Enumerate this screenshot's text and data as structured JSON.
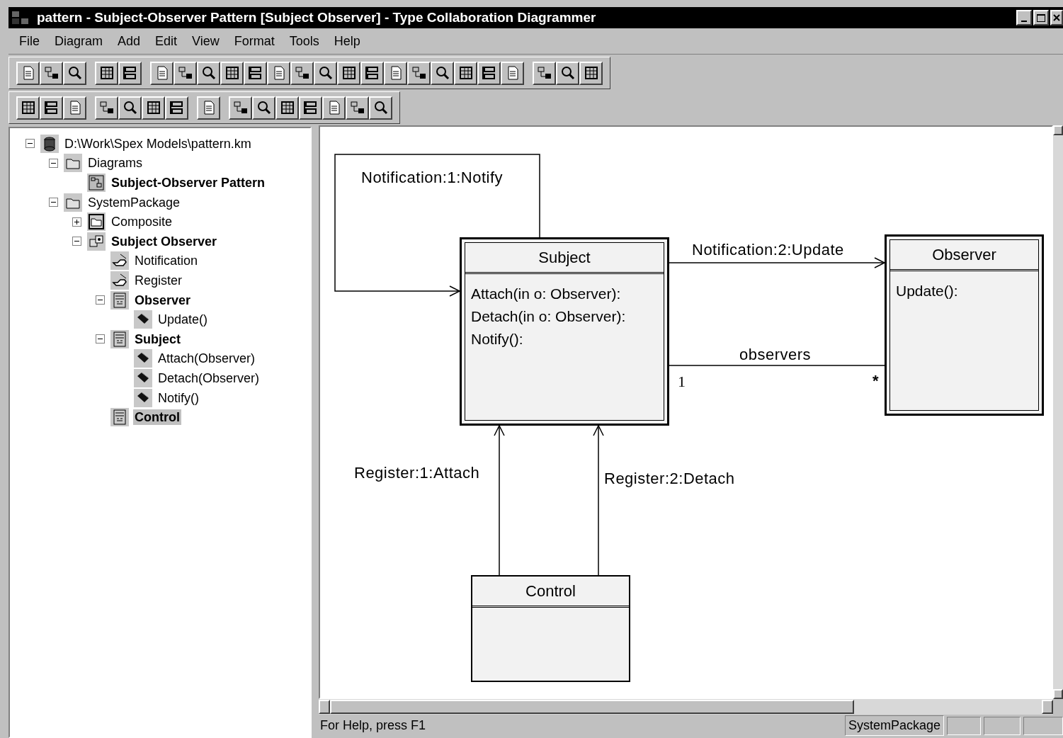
{
  "window": {
    "title": "pattern - Subject-Observer Pattern [Subject Observer] - Type Collaboration Diagrammer"
  },
  "menu": [
    {
      "label": "File"
    },
    {
      "label": "Diagram"
    },
    {
      "label": "Add"
    },
    {
      "label": "Edit"
    },
    {
      "label": "View"
    },
    {
      "label": "Format"
    },
    {
      "label": "Tools"
    },
    {
      "label": "Help"
    }
  ],
  "tree": [
    {
      "label": "D:\\Work\\Spex Models\\pattern.km",
      "kind": "database",
      "bold": false,
      "selected": false,
      "expanded": true,
      "children": [
        {
          "label": "Diagrams",
          "kind": "folder",
          "bold": false,
          "selected": false,
          "expanded": true,
          "children": [
            {
              "label": "Subject-Observer Pattern",
              "kind": "diagram",
              "bold": true,
              "selected": false
            }
          ]
        },
        {
          "label": "SystemPackage",
          "kind": "folder",
          "bold": false,
          "selected": false,
          "expanded": true,
          "children": [
            {
              "label": "Composite",
              "kind": "package",
              "bold": false,
              "selected": false,
              "expanded": false
            },
            {
              "label": "Subject Observer",
              "kind": "collaboration",
              "bold": true,
              "selected": false,
              "expanded": true,
              "children": [
                {
                  "label": "Notification",
                  "kind": "message",
                  "bold": false,
                  "selected": false
                },
                {
                  "label": "Register",
                  "kind": "message",
                  "bold": false,
                  "selected": false
                },
                {
                  "label": "Observer",
                  "kind": "class",
                  "bold": true,
                  "selected": false,
                  "expanded": true,
                  "children": [
                    {
                      "label": "Update()",
                      "kind": "operation",
                      "bold": false,
                      "selected": false
                    }
                  ]
                },
                {
                  "label": "Subject",
                  "kind": "class",
                  "bold": true,
                  "selected": false,
                  "expanded": true,
                  "children": [
                    {
                      "label": "Attach(Observer)",
                      "kind": "operation",
                      "bold": false,
                      "selected": false
                    },
                    {
                      "label": "Detach(Observer)",
                      "kind": "operation",
                      "bold": false,
                      "selected": false
                    },
                    {
                      "label": "Notify()",
                      "kind": "operation",
                      "bold": false,
                      "selected": false
                    }
                  ]
                },
                {
                  "label": "Control",
                  "kind": "class",
                  "bold": true,
                  "selected": true
                }
              ]
            }
          ]
        }
      ]
    }
  ],
  "diagram": {
    "classes": [
      {
        "name": "Subject",
        "double_border": true,
        "operations": [
          "Attach(in o: Observer):",
          "Detach(in o: Observer):",
          "Notify():"
        ]
      },
      {
        "name": "Observer",
        "double_border": true,
        "operations": [
          "Update():"
        ]
      },
      {
        "name": "Control",
        "double_border": false
      }
    ],
    "links": [
      {
        "kind": "message",
        "label": "Notification:1:Notify"
      },
      {
        "kind": "message",
        "label": "Notification:2:Update"
      },
      {
        "kind": "association",
        "label": "observers",
        "source_multiplicity": "1",
        "target_multiplicity": "*"
      },
      {
        "kind": "message",
        "label": "Register:1:Attach"
      },
      {
        "kind": "message",
        "label": "Register:2:Detach"
      }
    ]
  },
  "status_bar": {
    "message": "For Help, press F1",
    "panes": [
      "SystemPackage"
    ]
  }
}
